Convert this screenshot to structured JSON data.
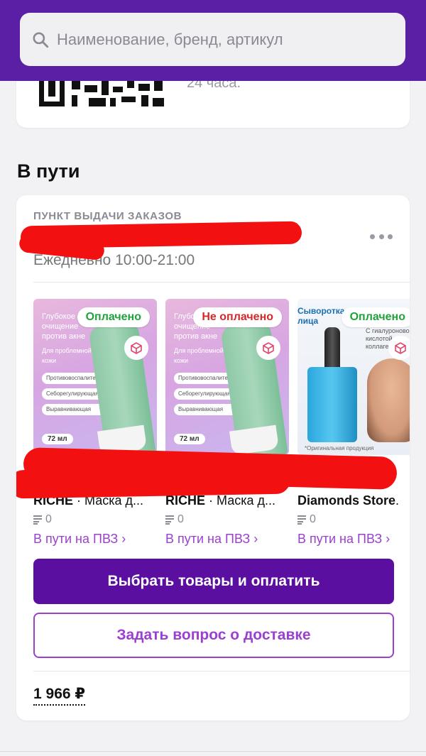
{
  "search": {
    "placeholder": "Наименование, бренд, артикул"
  },
  "top_card": {
    "caption": "24 часа."
  },
  "section": {
    "title": "В пути"
  },
  "pickup": {
    "label": "ПУНКТ ВЫДАЧИ ЗАКАЗОВ",
    "hours": "Ежедневно 10:00-21:00"
  },
  "products": [
    {
      "badge": "Оплачено",
      "badge_type": "paid",
      "brand": "RICHE",
      "name": " · Маска д...",
      "rating": "0",
      "status": "В пути на ПВЗ ›",
      "image": {
        "headline": "Глубокое очищение против акне",
        "sub": "Для проблемной кожи",
        "pills": [
          "Противовоспалительная",
          "Себорегулирующая",
          "Выравнивающая"
        ],
        "volume": "72 мл"
      }
    },
    {
      "badge": "Не оплачено",
      "badge_type": "unpaid",
      "brand": "RICHE",
      "name": " · Маска д...",
      "rating": "0",
      "status": "В пути на ПВЗ ›",
      "image": {
        "headline": "Глубокое очищение против акне",
        "sub": "Для проблемной кожи",
        "pills": [
          "Противовоспалительная",
          "Себорегулирующая",
          "Выравнивающая"
        ],
        "volume": "72 мл"
      }
    },
    {
      "badge": "Оплачено",
      "badge_type": "paid",
      "brand": "Diamonds Store",
      "name": ".",
      "rating": "0",
      "status": "В пути на ПВЗ ›",
      "image": {
        "headline": "Сыворотка для лица",
        "sub": "С гиалуроновой кислотой и коллагеном",
        "note": "*Оригинальная продукция"
      }
    }
  ],
  "actions": {
    "pay_label": "Выбрать товары и оплатить",
    "question_label": "Задать вопрос о доставке"
  },
  "total": "1 966 ₽",
  "colors": {
    "header": "#5b1fa6",
    "primary_button": "#5b0fa0",
    "accent": "#9b3fd1",
    "paid": "#1fa33a",
    "unpaid": "#d62828",
    "redaction": "#f21010"
  }
}
